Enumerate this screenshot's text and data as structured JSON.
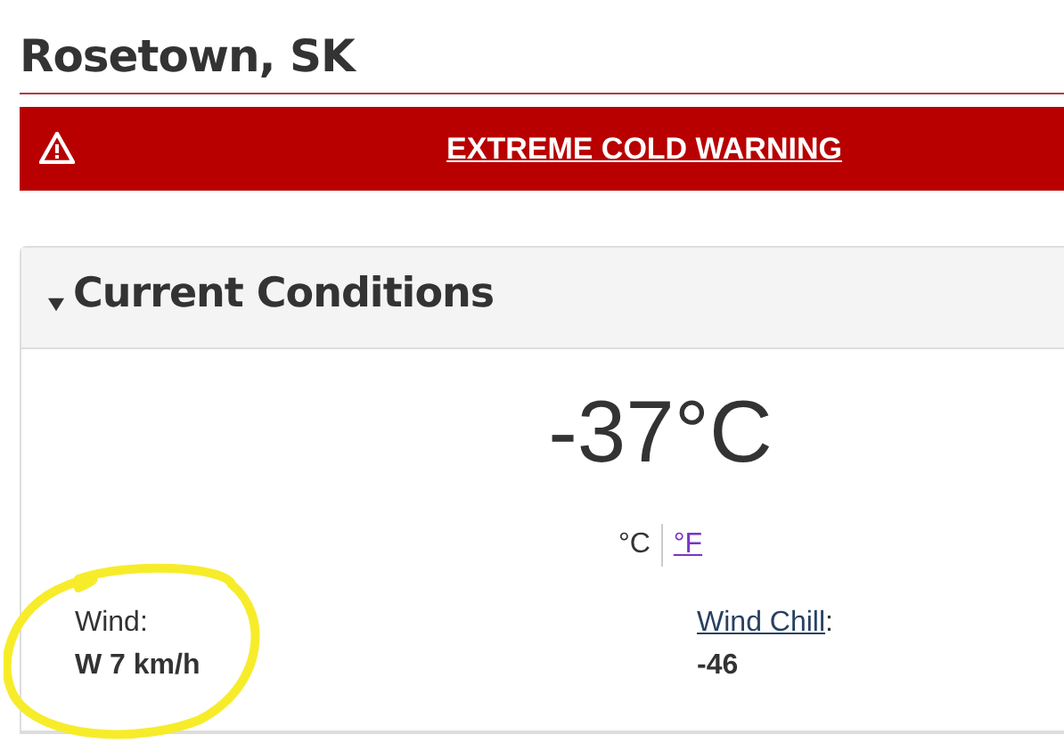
{
  "location": {
    "title": "Rosetown, SK"
  },
  "alert": {
    "kind": "warning",
    "text": "EXTREME COLD WARNING"
  },
  "current_conditions": {
    "heading": "Current Conditions",
    "expanded": true,
    "temperature": "-37°C",
    "units": [
      {
        "label": "°C",
        "selected": true
      },
      {
        "label": "°F",
        "selected": false
      }
    ],
    "details": [
      {
        "kind": "plain",
        "label": "Wind:",
        "value": "W 7 km/h"
      },
      {
        "kind": "link",
        "label": "Wind Chill",
        "suffix": ":",
        "value": "-46"
      }
    ]
  },
  "annotation": {
    "kind": "circle"
  }
}
